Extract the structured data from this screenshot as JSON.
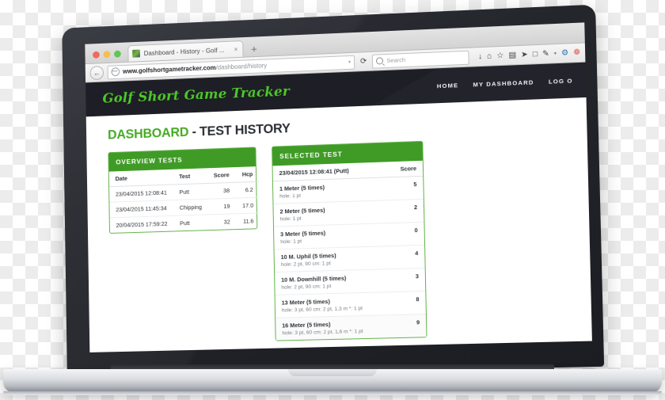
{
  "browser": {
    "tab": {
      "title": "Dashboard - History - Golf ...",
      "close_label": "×",
      "favicon_name": "site-favicon"
    },
    "newtab_label": "+",
    "back_label": "←",
    "reload_label": "⟳",
    "url": {
      "domain": "www.golfshortgametracker.com",
      "path": "/dashboard/history",
      "caret": "▾"
    },
    "search": {
      "placeholder": "Search"
    },
    "toolbar_icons": [
      {
        "name": "download-icon",
        "glyph": "↓",
        "color": "#3d4045"
      },
      {
        "name": "home-icon",
        "glyph": "⌂",
        "color": "#3d4045"
      },
      {
        "name": "bookmark-star-icon",
        "glyph": "☆",
        "color": "#3d4045"
      },
      {
        "name": "clipboard-icon",
        "glyph": "▤",
        "color": "#3d4045"
      },
      {
        "name": "paper-plane-icon",
        "glyph": "➤",
        "color": "#3d4045"
      },
      {
        "name": "window-square-icon",
        "glyph": "□",
        "color": "#3d4045"
      },
      {
        "name": "pencil-icon",
        "glyph": "✎",
        "color": "#3d4045"
      },
      {
        "name": "dropdown-caret-icon",
        "glyph": "▾",
        "color": "#6d7176"
      },
      {
        "name": "settings-gear-icon",
        "glyph": "⚙",
        "color": "#2b6fb5"
      },
      {
        "name": "lifebuoy-icon",
        "glyph": "❁",
        "color": "#d95c4a"
      }
    ]
  },
  "site": {
    "brand": "Golf Short Game Tracker",
    "nav": [
      {
        "name": "nav-home",
        "label": "HOME"
      },
      {
        "name": "nav-my-dashboard",
        "label": "MY DASHBOARD"
      },
      {
        "name": "nav-log-out",
        "label": "LOG O"
      }
    ],
    "title": {
      "primary": "DASHBOARD",
      "secondary": "- TEST HISTORY"
    },
    "colors": {
      "brand_green": "#4ec72b",
      "panel_green": "#3f9b26",
      "title_green": "#45ab23",
      "header_dark": "#1e1f26"
    },
    "overview_panel": {
      "heading": "OVERVIEW TESTS",
      "columns": [
        "Date",
        "Test",
        "Score",
        "Hcp"
      ],
      "rows": [
        {
          "date": "23/04/2015 12:08:41",
          "test": "Putt",
          "score": "38",
          "hcp": "6.2"
        },
        {
          "date": "23/04/2015 11:45:34",
          "test": "Chipping",
          "score": "19",
          "hcp": "17.0"
        },
        {
          "date": "20/04/2015 17:59:22",
          "test": "Putt",
          "score": "32",
          "hcp": "11.6"
        }
      ]
    },
    "selected_panel": {
      "heading": "SELECTED TEST",
      "subheading": "23/04/2015 12:08:41 (Putt)",
      "score_label": "Score",
      "rows": [
        {
          "name": "1 Meter (5 times)",
          "detail": "hole: 1 pt",
          "score": "5"
        },
        {
          "name": "2 Meter (5 times)",
          "detail": "hole: 1 pt",
          "score": "2"
        },
        {
          "name": "3 Meter (5 times)",
          "detail": "hole: 1 pt",
          "score": "0"
        },
        {
          "name": "10 M. Uphil (5 times)",
          "detail": "hole: 2 pt, 90 cm: 1 pt",
          "score": "4"
        },
        {
          "name": "10 M. Downhill (5 times)",
          "detail": "hole: 2 pt, 90 cm: 1 pt",
          "score": "3"
        },
        {
          "name": "13 Meter (5 times)",
          "detail": "hole: 3 pt, 60 cm: 2 pt, 1,3 m *: 1 pt",
          "score": "8"
        },
        {
          "name": "16 Meter (5 times)",
          "detail": "hole: 3 pt, 60 cm: 2 pt, 1,6 m *: 1 pt",
          "score": "9"
        }
      ]
    }
  }
}
